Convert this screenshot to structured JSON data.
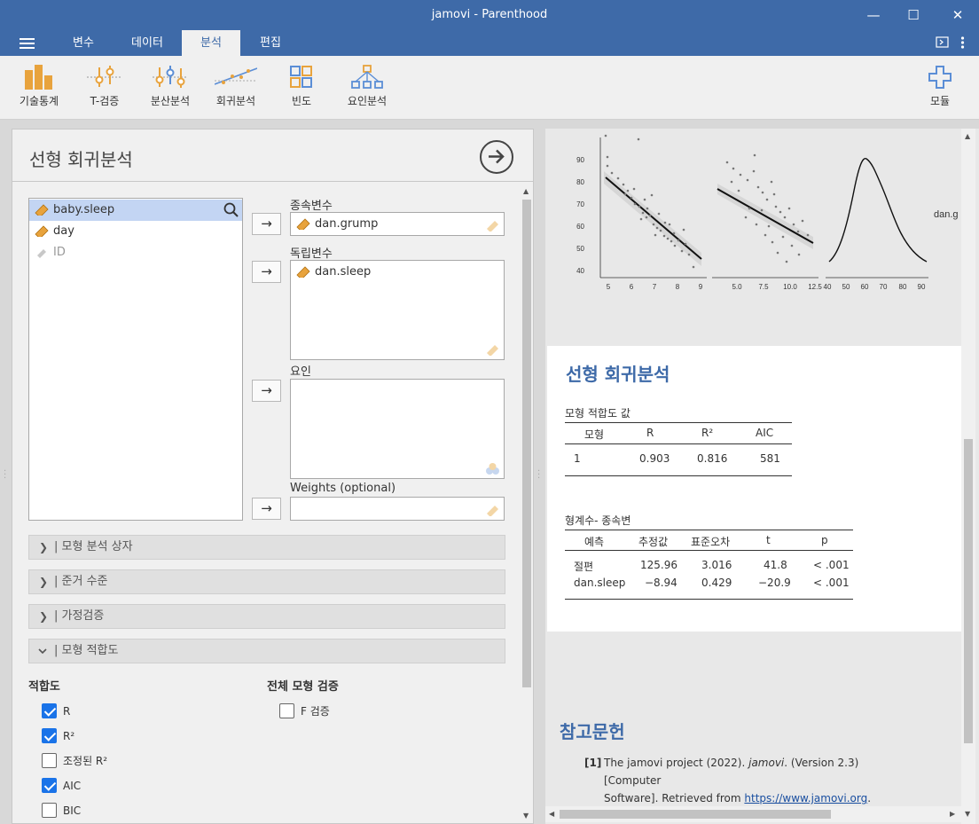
{
  "window": {
    "title": "jamovi - Parenthood",
    "minimize": "—",
    "maximize": "☐",
    "close": "✕"
  },
  "menu": {
    "tabs": [
      "변수",
      "데이터",
      "분석",
      "편집"
    ],
    "active": "분석"
  },
  "ribbon": {
    "items": [
      "기술통계",
      "T-검증",
      "분산분석",
      "회귀분석",
      "빈도",
      "요인분석"
    ],
    "modules": "모듈"
  },
  "analysis": {
    "title": "선형 회귀분석",
    "variables": [
      {
        "name": "baby.sleep",
        "state": "selected"
      },
      {
        "name": "day",
        "state": "normal"
      },
      {
        "name": "ID",
        "state": "disabled"
      }
    ],
    "arrow": "→",
    "dependent": {
      "label": "종속변수",
      "value": "dan.grump"
    },
    "covariates": {
      "label": "독립변수",
      "items": [
        "dan.sleep"
      ]
    },
    "factors": {
      "label": "요인"
    },
    "weights": {
      "label": "Weights (optional)"
    },
    "sections": [
      {
        "label": "| 모형 분석 상자",
        "chevron": "›"
      },
      {
        "label": "| 준거 수준",
        "chevron": "›"
      },
      {
        "label": "| 가정검증",
        "chevron": "›"
      },
      {
        "label": "| 모형 적합도",
        "chevron": "⌄"
      }
    ],
    "fit": {
      "heading": "적합도",
      "options": [
        {
          "label": "R",
          "checked": true
        },
        {
          "label": "R²",
          "checked": true
        },
        {
          "label": "조정된 R²",
          "checked": false
        },
        {
          "label": "AIC",
          "checked": true
        },
        {
          "label": "BIC",
          "checked": false
        }
      ]
    },
    "overall": {
      "heading": "전체 모형 검증",
      "options": [
        {
          "label": "F 검증",
          "checked": false
        }
      ]
    }
  },
  "results": {
    "plot": {
      "y_ticks": [
        "90",
        "80",
        "70",
        "60",
        "50",
        "40"
      ],
      "x_ticks_1": [
        "5",
        "6",
        "7",
        "8",
        "9"
      ],
      "x_ticks_2": [
        "5.0",
        "7.5",
        "10.0",
        "12.5"
      ],
      "x_ticks_3": [
        "40",
        "50",
        "60",
        "70",
        "80",
        "90"
      ],
      "side_label": "dan.g"
    },
    "heading": "선형 회귀분석",
    "fit_table": {
      "title": "모형 적합도 값",
      "headers": [
        "모형",
        "R",
        "R²",
        "AIC"
      ],
      "row": [
        "1",
        "0.903",
        "0.816",
        "581"
      ]
    },
    "coef_table": {
      "title": "형계수- 종속변",
      "headers": [
        "예측",
        "추정값",
        "표준오차",
        "t",
        "p"
      ],
      "rows": [
        [
          "절편",
          "125.96",
          "3.016",
          "41.8",
          "< .001"
        ],
        [
          "dan.sleep",
          "−8.94",
          "0.429",
          "−20.9",
          "< .001"
        ]
      ]
    },
    "references": {
      "heading": "참고문헌",
      "num": "[1]",
      "text_a": "The jamovi project (2022). ",
      "text_em": "jamovi",
      "text_b": ". (Version 2.3) [Computer",
      "text_c": "Software]. Retrieved from ",
      "link": "https://www.jamovi.org",
      "text_d": "."
    }
  }
}
